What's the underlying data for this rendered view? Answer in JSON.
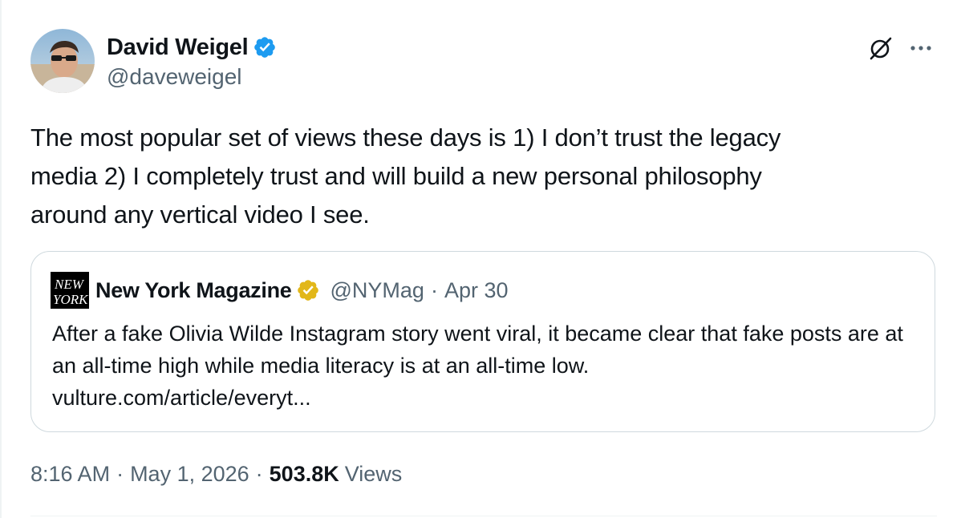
{
  "author": {
    "display_name": "David Weigel",
    "handle": "@daveweigel",
    "verified": true,
    "verified_color": "#1d9bf0"
  },
  "tweet": {
    "text": "The most popular set of views these days is 1) I don’t trust the legacy\nmedia 2) I completely trust and will build a new personal philosophy\naround any vertical video I see."
  },
  "header_actions": {
    "grok_icon": "grok-icon",
    "more_icon": "more-icon"
  },
  "quote": {
    "logo_text_line1": "NEW",
    "logo_text_line2": "YORK",
    "display_name": "New York Magazine",
    "verified_color": "#e2b719",
    "handle": "@NYMag",
    "separator": "·",
    "date": "Apr 30",
    "text": "After a fake Olivia Wilde Instagram story went viral, it became clear that fake posts are at an all-time high while media literacy is at an all-time low.",
    "link": "vulture.com/article/everyt..."
  },
  "meta": {
    "time": "8:16 AM",
    "separator": "·",
    "date": "May 1, 2026",
    "views_count": "503.8K",
    "views_label": "Views"
  },
  "colors": {
    "text": "#0f1419",
    "secondary": "#536471",
    "border": "#cfd9de"
  }
}
